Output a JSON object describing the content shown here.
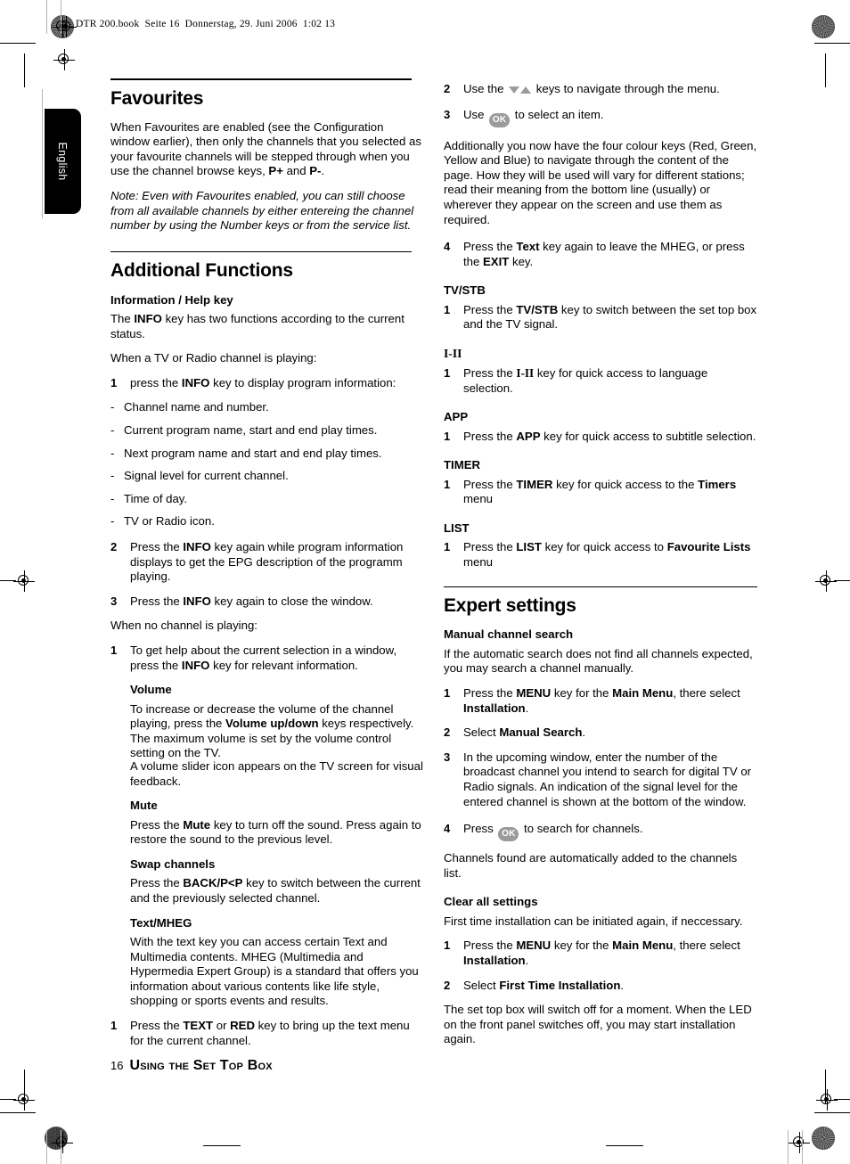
{
  "document": {
    "header_slug": "DTR 200.book  Seite 16  Donnerstag, 29. Juni 2006  1:02 13",
    "language_tab": "English",
    "footer": {
      "page_number": "16",
      "running_title": "Using the Set Top Box"
    }
  },
  "left_column": {
    "favourites": {
      "heading": "Favourites",
      "paragraph": "When Favourites are enabled (see the Configuration window earlier), then only the channels that you selected as your favourite channels will be stepped through when you use the channel browse keys, ",
      "p_bold_1": "P+",
      "p_mid": " and ",
      "p_bold_2": "P-",
      "p_end": ".",
      "note": "Note:  Even with Favourites enabled, you can still choose from all available channels by either entereing the channel number by using the Number keys or from the service list."
    },
    "additional_functions": {
      "heading": "Additional Functions",
      "info_help": {
        "sub_heading": "Information / Help key",
        "intro_a": "The ",
        "intro_b": "INFO",
        "intro_c": " key has two functions according to the current status.",
        "playing_label": "When a TV or Radio channel is playing:",
        "step1": {
          "num": "1",
          "a": "press the ",
          "b": "INFO",
          "c": " key to display program information:"
        },
        "bullets": [
          "Channel name and number.",
          "Current program name, start and end play times.",
          "Next program name and start and end play times.",
          "Signal level for current channel.",
          "Time of day.",
          "TV or Radio icon."
        ],
        "step2": {
          "num": "2",
          "a": "Press the ",
          "b": "INFO",
          "c": " key again while program information displays to get the EPG description of the programm playing."
        },
        "step3": {
          "num": "3",
          "a": "Press the ",
          "b": "INFO",
          "c": " key again to close the window."
        },
        "no_channel_label": "When no channel is playing:",
        "step4": {
          "num": "1",
          "a": "To get help about the current selection in a window, press the ",
          "b": "INFO",
          "c": " key for relevant information."
        }
      },
      "volume": {
        "sub_heading": "Volume",
        "a": "To increase or decrease the volume of the channel playing, press the ",
        "b": "Volume up/down",
        "c": " keys respectively. The maximum volume is set by the volume control setting on the TV.",
        "second": "A volume slider icon appears on the TV screen for visual feedback."
      },
      "mute": {
        "sub_heading": "Mute",
        "a": "Press the ",
        "b": "Mute",
        "c": " key to turn off the sound. Press again to restore the sound to the previous level."
      },
      "swap_channels": {
        "sub_heading": "Swap channels",
        "a": "Press the ",
        "b": "BACK/P<P",
        "c": " key to switch between the current and the  previously selected channel."
      },
      "text_mheg": {
        "sub_heading": "Text/MHEG",
        "paragraph": "With the text key you can access certain Text and Multimedia contents. MHEG (Multimedia and Hypermedia Expert Group) is a standard that offers you information about various contents like life style, shopping or sports events and results.",
        "step1": {
          "num": "1",
          "a": "Press the ",
          "b": "TEXT",
          "c": " or ",
          "d": "RED",
          "e": " key to bring up the text menu for the current channel."
        }
      }
    }
  },
  "right_column": {
    "mheg_continued": {
      "step2": {
        "num": "2",
        "a": "Use the ",
        "icon": "down-up-arrow-keys-icon",
        "b": " keys to navigate through the menu."
      },
      "step3": {
        "num": "3",
        "a": "Use ",
        "icon": "ok-key-icon",
        "b": " to select an item."
      },
      "colour_keys_paragraph": "Additionally you now have the four colour keys (Red, Green, Yellow and Blue) to navigate through the content of the page. How they will be used will vary for different stations; read their meaning from the bottom line (usually) or wherever they appear on the screen and use them as required.",
      "step4": {
        "num": "4",
        "a": "Press the ",
        "b": "Text",
        "c": " key again to leave the MHEG, or press the ",
        "d": "EXIT",
        "e": " key."
      }
    },
    "tv_stb": {
      "sub_heading": "TV/STB",
      "step": {
        "num": "1",
        "a": "Press the ",
        "b": "TV/STB",
        "c": " key to switch between the set top box and the TV signal."
      }
    },
    "i_ii": {
      "sub_heading": "I-II",
      "step": {
        "num": "1",
        "a": "Press the ",
        "b": "I-II",
        "c": " key for quick access to language selection."
      }
    },
    "app": {
      "sub_heading": "APP",
      "step": {
        "num": "1",
        "a": "Press the ",
        "b": "APP",
        "c": " key for quick access to subtitle selection."
      }
    },
    "timer": {
      "sub_heading": "TIMER",
      "step": {
        "num": "1",
        "a": "Press the ",
        "b": "TIMER",
        "c": " key for quick access to the ",
        "d": "Timers",
        "e": " menu"
      }
    },
    "list": {
      "sub_heading": "LIST",
      "step": {
        "num": "1",
        "a": "Press the ",
        "b": "LIST",
        "c": " key for quick access to ",
        "d": "Favourite Lists",
        "e": " menu"
      }
    },
    "expert_settings": {
      "heading": "Expert settings",
      "manual_channel_search": {
        "sub_heading": "Manual channel search",
        "paragraph": "If the automatic search does not find all channels expected, you may search a channel manually.",
        "step1": {
          "num": "1",
          "a": "Press the ",
          "b": "MENU",
          "c": " key for the ",
          "d": "Main Menu",
          "e": ", there select ",
          "f": "Installation",
          "g": "."
        },
        "step2": {
          "num": "2",
          "a": "Select ",
          "b": "Manual Search",
          "c": "."
        },
        "step3": {
          "num": "3",
          "a": "In the upcoming window, enter the number of the broadcast channel you intend to search for digital TV or Radio signals. An indication of the signal level for the entered channel is shown at the bottom of the window."
        },
        "step4": {
          "num": "4",
          "a": "Press ",
          "icon": "ok-key-icon",
          "b": " to search for channels."
        },
        "result": "Channels found are automatically added to the channels list."
      },
      "clear_all_settings": {
        "sub_heading": "Clear all settings",
        "paragraph": "First time installation can be initiated again, if neccessary.",
        "step1": {
          "num": "1",
          "a": "Press the ",
          "b": "MENU",
          "c": " key for the ",
          "d": "Main Menu",
          "e": ", there select ",
          "f": "Installation",
          "g": "."
        },
        "step2": {
          "num": "2",
          "a": "Select ",
          "b": "First Time Installation",
          "c": "."
        },
        "closing": "The set top box will switch off for a moment. When the LED on the front panel switches off, you may start installation again."
      }
    }
  }
}
